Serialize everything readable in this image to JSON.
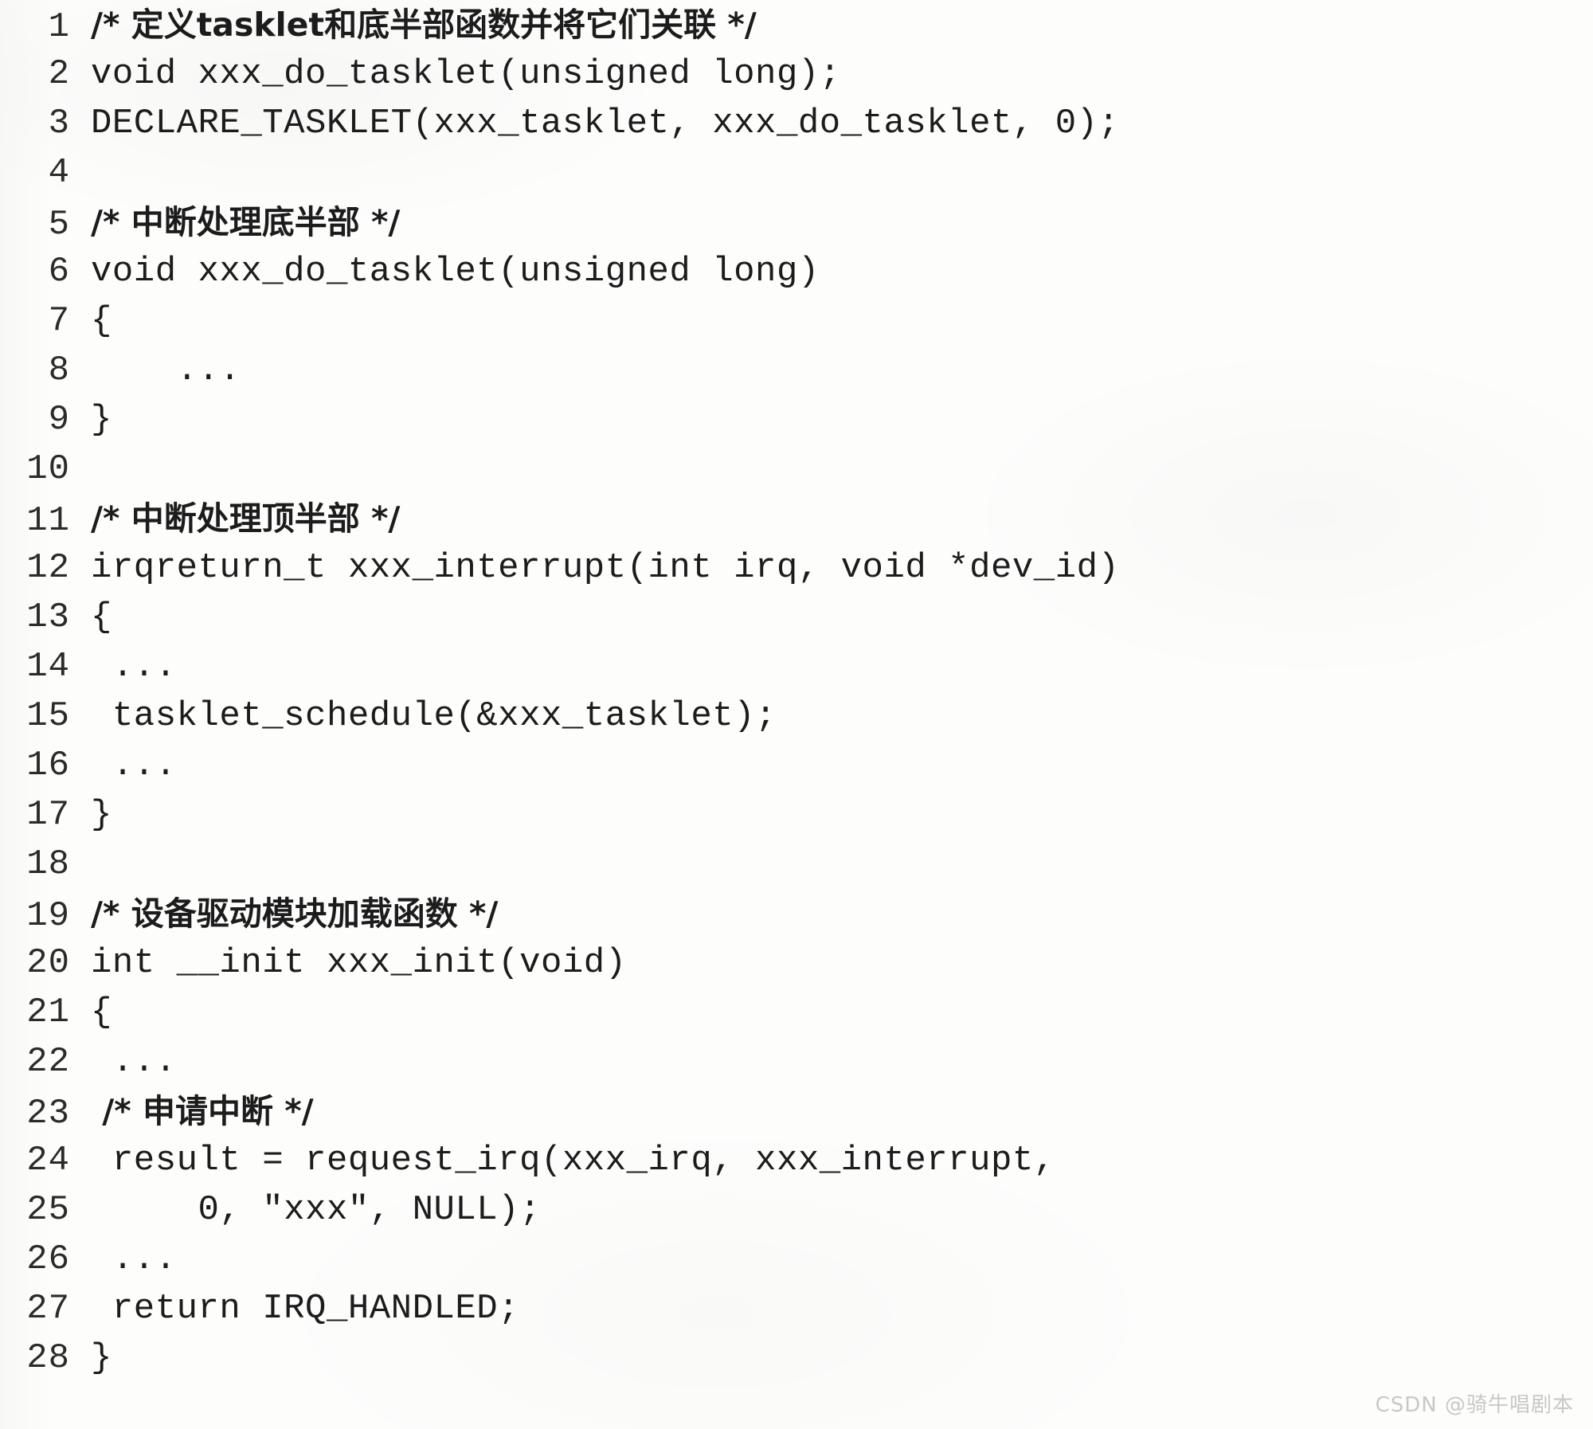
{
  "document": {
    "type": "scanned-code-listing",
    "language": "c",
    "paper_color": "#fdfdfc",
    "ink_color": "#1c1c1c",
    "lines": [
      {
        "number": "1",
        "code": "/* 定义tasklet和底半部函数并将它们关联 */",
        "cjk": true
      },
      {
        "number": "2",
        "code": "void xxx_do_tasklet(unsigned long);",
        "cjk": false
      },
      {
        "number": "3",
        "code": "DECLARE_TASKLET(xxx_tasklet, xxx_do_tasklet, 0);",
        "cjk": false
      },
      {
        "number": "4",
        "code": "",
        "cjk": false
      },
      {
        "number": "5",
        "code": "/* 中断处理底半部 */",
        "cjk": true
      },
      {
        "number": "6",
        "code": "void xxx_do_tasklet(unsigned long)",
        "cjk": false
      },
      {
        "number": "7",
        "code": "{",
        "cjk": false
      },
      {
        "number": "8",
        "code": "    ...",
        "cjk": false
      },
      {
        "number": "9",
        "code": "}",
        "cjk": false
      },
      {
        "number": "10",
        "code": "",
        "cjk": false
      },
      {
        "number": "11",
        "code": "/* 中断处理顶半部 */",
        "cjk": true
      },
      {
        "number": "12",
        "code": "irqreturn_t xxx_interrupt(int irq, void *dev_id)",
        "cjk": false
      },
      {
        "number": "13",
        "code": "{",
        "cjk": false
      },
      {
        "number": "14",
        "code": " ...",
        "cjk": false
      },
      {
        "number": "15",
        "code": " tasklet_schedule(&xxx_tasklet);",
        "cjk": false
      },
      {
        "number": "16",
        "code": " ...",
        "cjk": false
      },
      {
        "number": "17",
        "code": "}",
        "cjk": false
      },
      {
        "number": "18",
        "code": "",
        "cjk": false
      },
      {
        "number": "19",
        "code": "/* 设备驱动模块加载函数 */",
        "cjk": true
      },
      {
        "number": "20",
        "code": "int __init xxx_init(void)",
        "cjk": false
      },
      {
        "number": "21",
        "code": "{",
        "cjk": false
      },
      {
        "number": "22",
        "code": " ...",
        "cjk": false
      },
      {
        "number": "23",
        "code": " /* 申请中断 */",
        "cjk": true
      },
      {
        "number": "24",
        "code": " result = request_irq(xxx_irq, xxx_interrupt,",
        "cjk": false
      },
      {
        "number": "25",
        "code": "     0, \"xxx\", NULL);",
        "cjk": false
      },
      {
        "number": "26",
        "code": " ...",
        "cjk": false
      },
      {
        "number": "27",
        "code": " return IRQ_HANDLED;",
        "cjk": false
      },
      {
        "number": "28",
        "code": "}",
        "cjk": false
      }
    ]
  },
  "watermark": {
    "text": "CSDN @骑牛唱剧本",
    "color": "#c8c8c8"
  }
}
